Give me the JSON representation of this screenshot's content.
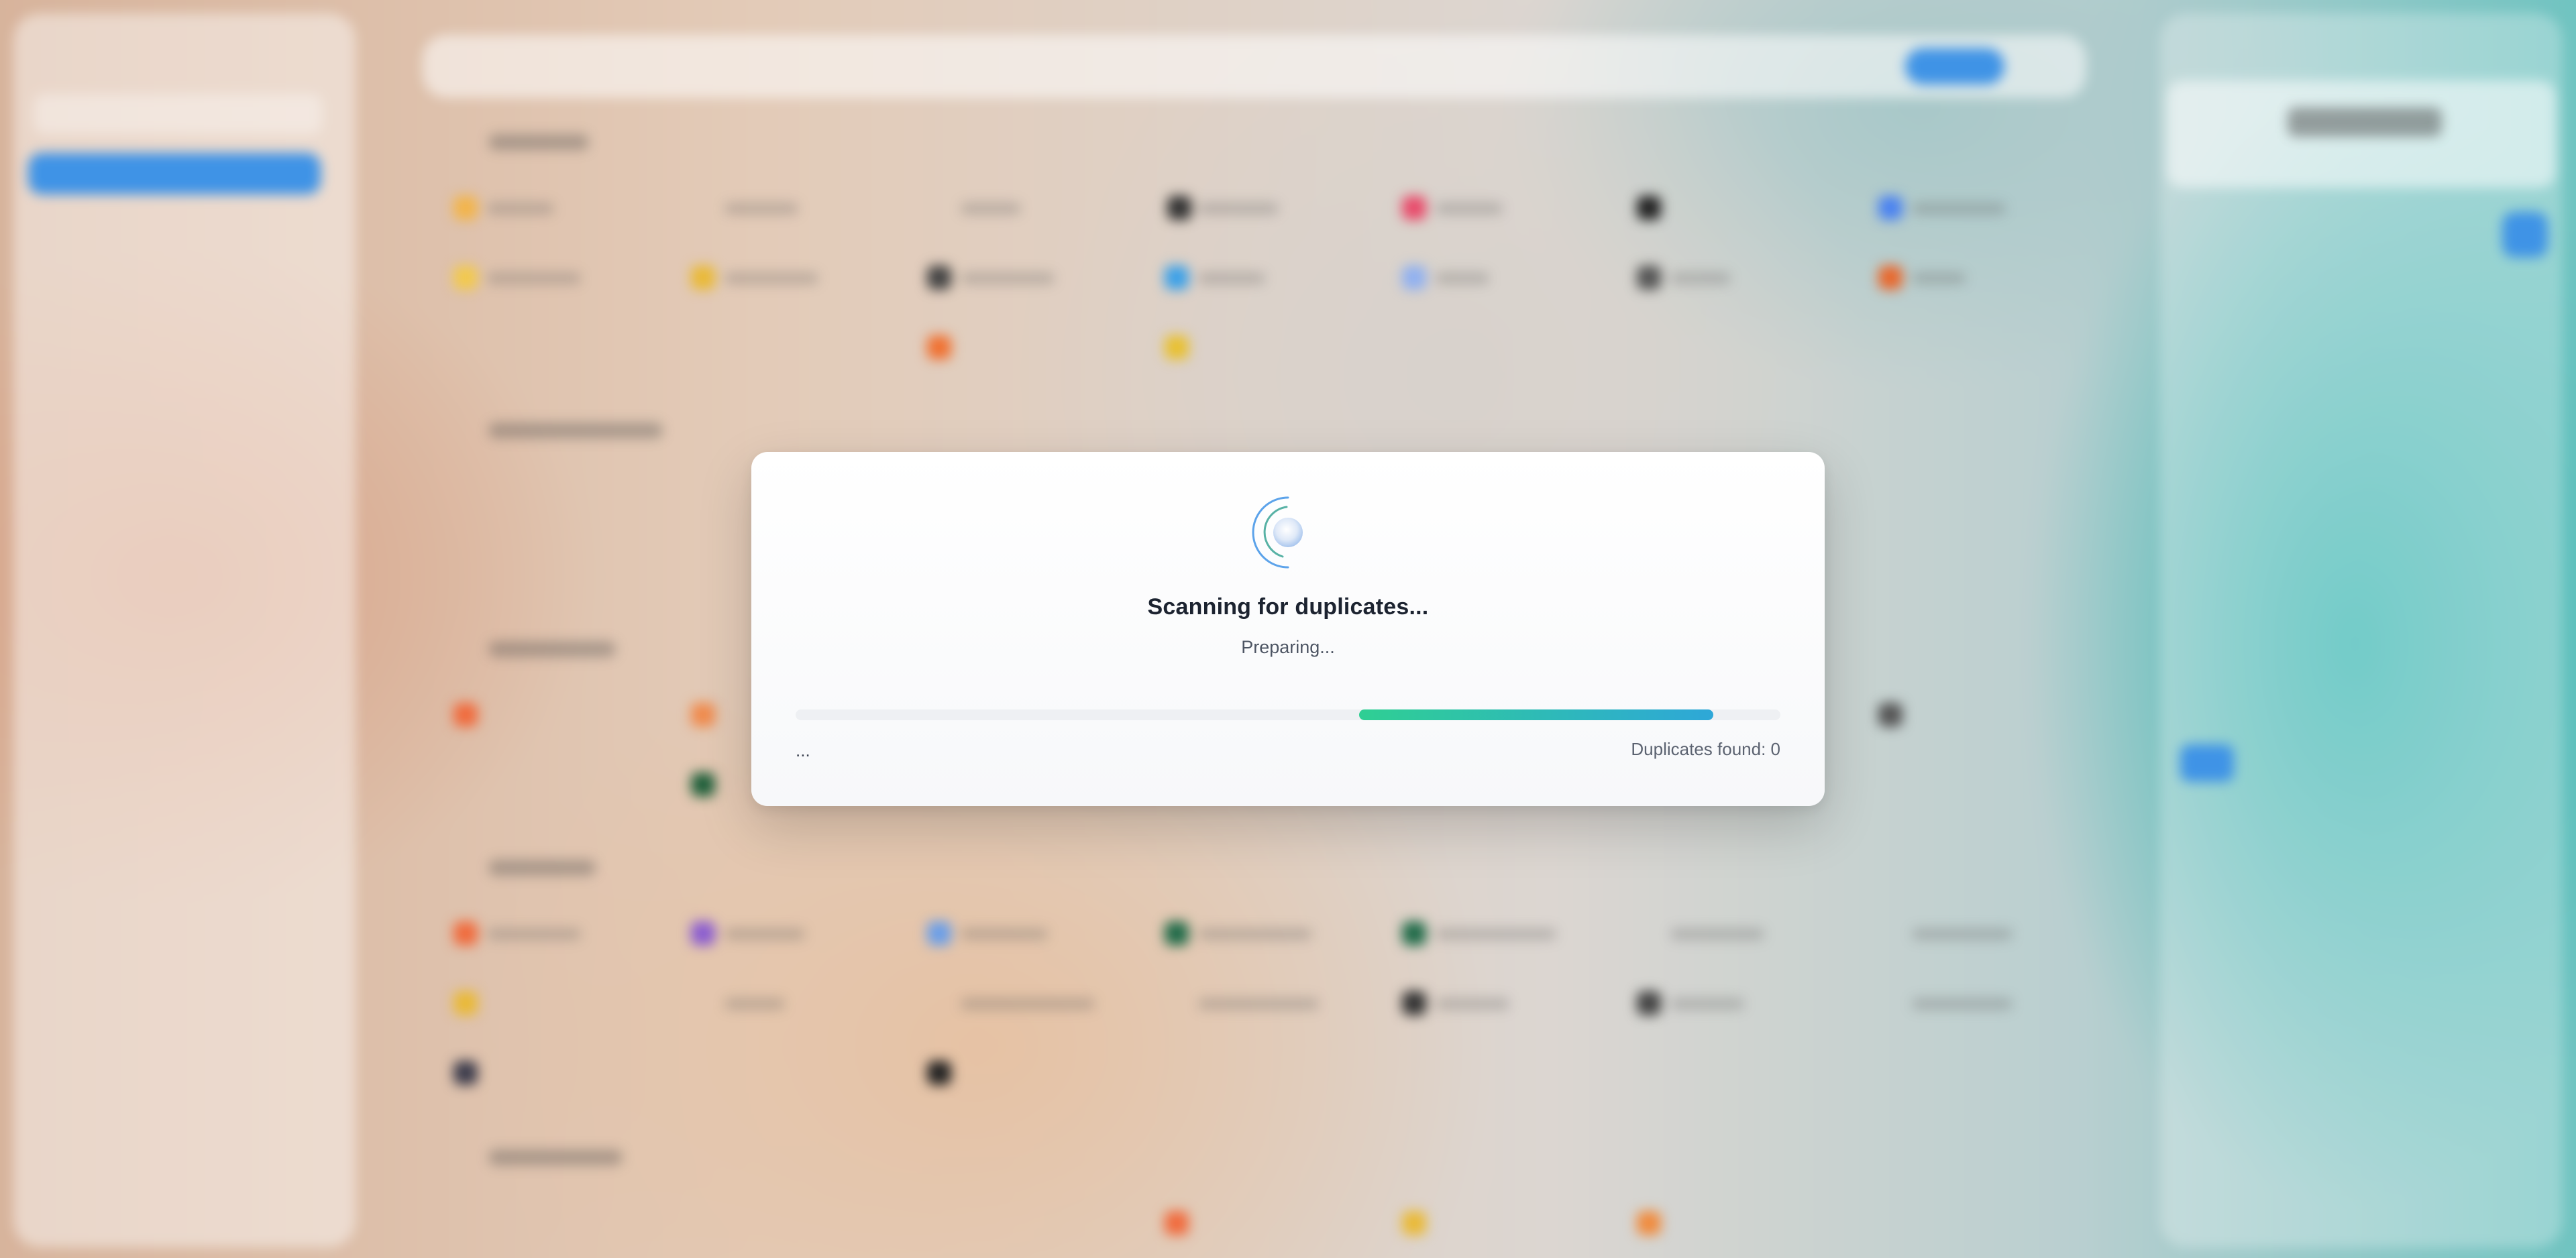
{
  "dialog": {
    "title": "Scanning for duplicates...",
    "status": "Preparing...",
    "progress_note": "...",
    "duplicates_label": "Duplicates found: 0",
    "progress_start_fraction": 0.572,
    "progress_end_fraction": 0.932
  },
  "colors": {
    "progress_start": "#2fcf93",
    "progress_end": "#2ea7d8",
    "spinner": "#3f93e6"
  },
  "icons": {
    "spinner": "spinner-icon"
  }
}
